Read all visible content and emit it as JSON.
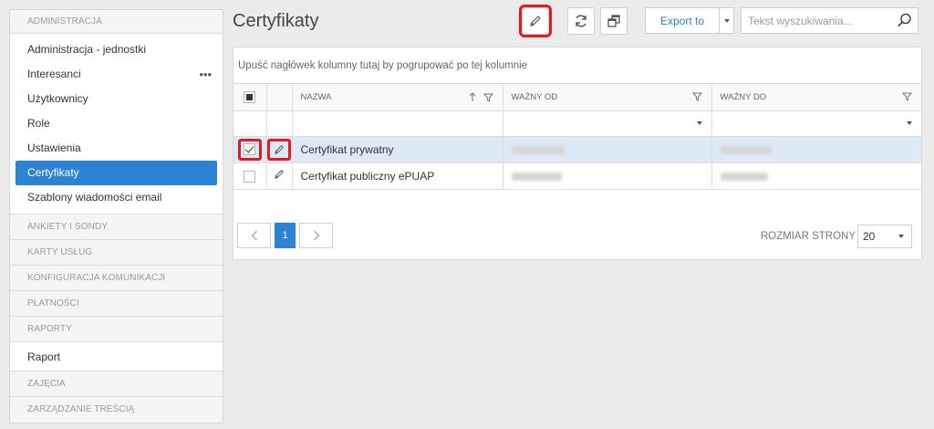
{
  "sidebar": {
    "sections": {
      "administracja": "ADMINISTRACJA",
      "ankiety": "ANKIETY I SONDY",
      "karty": "KARTY USŁUG",
      "konfiguracja": "KONFIGURACJA KOMUNIKACJI",
      "platnosci": "PŁATNOŚCI",
      "raporty": "RAPORTY",
      "zajecia": "ZAJĘCIA",
      "zarzadzanie": "ZARZĄDZANIE TREŚCIĄ"
    },
    "admin_items": [
      {
        "label": "Administracja - jednostki"
      },
      {
        "label": "Interesanci",
        "more": "•••"
      },
      {
        "label": "Użytkownicy"
      },
      {
        "label": "Role"
      },
      {
        "label": "Ustawienia"
      },
      {
        "label": "Certyfikaty",
        "active": true
      },
      {
        "label": "Szablony wiadomości email"
      }
    ],
    "raport_item": "Raport"
  },
  "header": {
    "title": "Certyfikaty",
    "toolbar_icons": [
      "pencil-icon",
      "refresh-icon",
      "restore-window-icon"
    ],
    "export_label": "Export to",
    "search_placeholder": "Tekst wyszukiwania..."
  },
  "grid": {
    "group_hint": "Upuść nagłówek kolumny tutaj by pogrupować po tej kolumnie",
    "columns": {
      "name": "NAZWA",
      "valid_from": "WAŻNY OD",
      "valid_to": "WAŻNY DO"
    },
    "rows": [
      {
        "name": "Certyfikat prywatny",
        "selected": true
      },
      {
        "name": "Certyfikat publiczny ePUAP",
        "selected": false
      }
    ],
    "pager": {
      "prev": "<",
      "current_page": "1",
      "next": ">",
      "page_size_label": "ROZMIAR STRONY",
      "page_size": "20"
    }
  },
  "colors": {
    "accent": "#2c83d3",
    "highlight": "#e01b22",
    "selected_row": "#dde9f6"
  }
}
